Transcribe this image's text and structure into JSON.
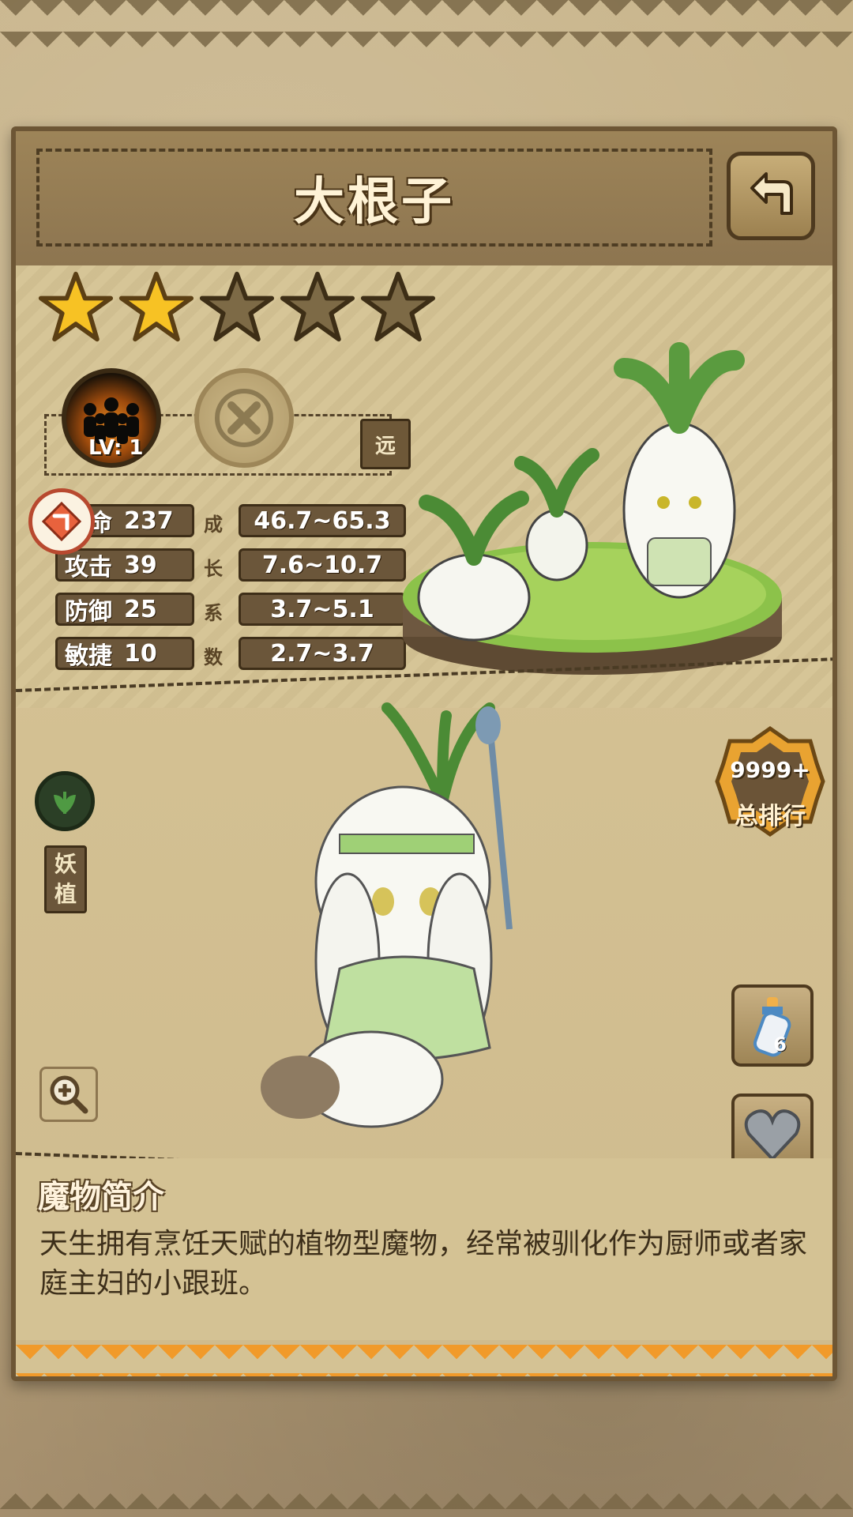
{
  "monster": {
    "name": "大根子",
    "stars_total": 5,
    "stars_filled": 2,
    "skill_level": "LV: 1",
    "range_tag": "远",
    "type_tag": [
      "妖",
      "植"
    ]
  },
  "stats": [
    {
      "label": "生命",
      "value": "237",
      "growth": "46.7~65.3"
    },
    {
      "label": "攻击",
      "value": "39",
      "growth": "7.6~10.7"
    },
    {
      "label": "防御",
      "value": "25",
      "growth": "3.7~5.1"
    },
    {
      "label": "敏捷",
      "value": "10",
      "growth": "2.7~3.7"
    }
  ],
  "growth_label_chars": [
    "成",
    "长",
    "系",
    "数"
  ],
  "rank": {
    "value": "9999+",
    "label": "总排行"
  },
  "items": {
    "bottle_count": "6"
  },
  "description": {
    "title": "魔物简介",
    "text": "天生拥有烹饪天赋的植物型魔物，经常被驯化作为厨师或者家庭主妇的小跟班。"
  },
  "icons": {
    "back": "back-arrow-icon",
    "star_filled": "star-filled-icon",
    "star_empty": "star-empty-icon",
    "skill": "crowd-skill-icon",
    "locked_skill": "locked-x-icon",
    "plant": "leaf-icon",
    "zoom": "zoom-in-icon",
    "milk": "milk-bottle-icon",
    "heart": "heart-stone-icon",
    "rank": "rank-badge-icon"
  },
  "colors": {
    "accent_orange": "#f19a2a",
    "panel_brown": "#6b563a",
    "star_gold": "#f7c224"
  }
}
